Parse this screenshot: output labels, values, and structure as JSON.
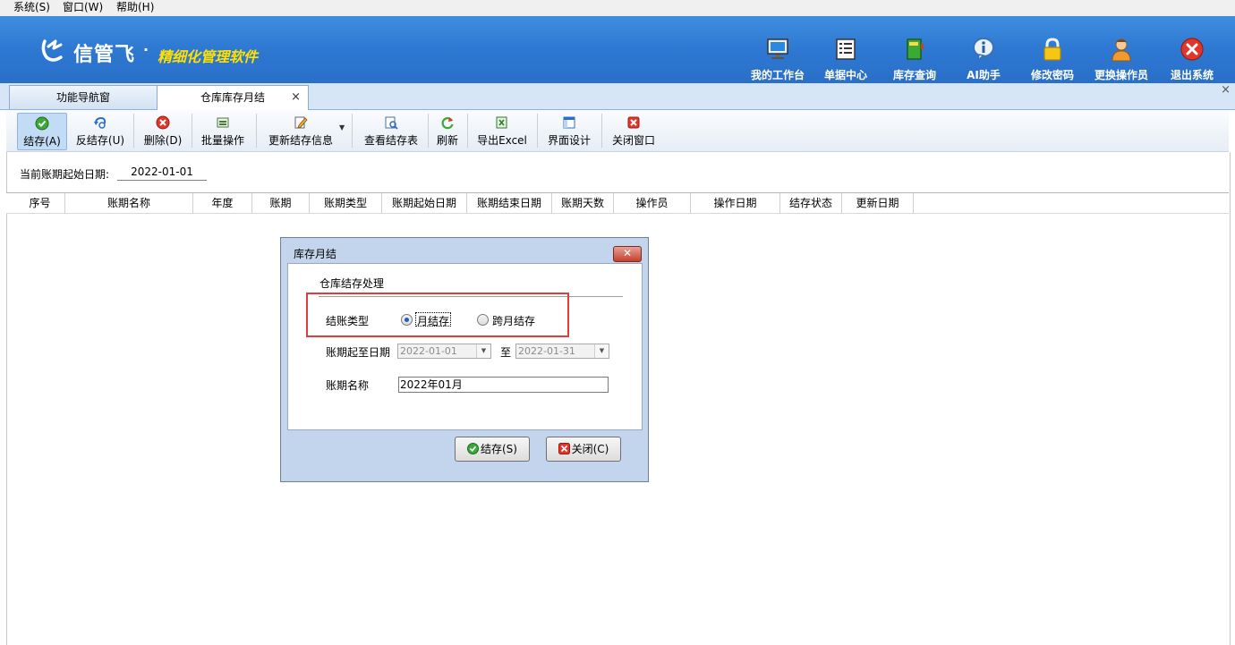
{
  "menu": [
    "系统(S)",
    "窗口(W)",
    "帮助(H)"
  ],
  "banner": {
    "logo_name": "信管飞",
    "logo_dot": "·",
    "slogan": "精细化管理软件",
    "buttons": [
      {
        "label": "我的工作台",
        "icon": "monitor-icon"
      },
      {
        "label": "单据中心",
        "icon": "document-list-icon"
      },
      {
        "label": "库存查询",
        "icon": "book-icon"
      },
      {
        "label": "AI助手",
        "icon": "info-icon"
      },
      {
        "label": "修改密码",
        "icon": "lock-icon"
      },
      {
        "label": "更换操作员",
        "icon": "user-icon"
      },
      {
        "label": "退出系统",
        "icon": "exit-icon"
      }
    ]
  },
  "tabs": [
    {
      "label": "功能导航窗"
    },
    {
      "label": "仓库库存月结",
      "close": "×"
    }
  ],
  "strip_close": "×",
  "toolbar": [
    {
      "label": "结存(A)",
      "icon": "check-icon"
    },
    {
      "label": "反结存(U)",
      "icon": "undo-icon"
    },
    {
      "label": "删除(D)",
      "icon": "delete-icon"
    },
    {
      "label": "批量操作",
      "icon": "batch-icon"
    },
    {
      "label": "更新结存信息",
      "icon": "edit-icon"
    },
    {
      "label": "查看结存表",
      "icon": "view-table-icon"
    },
    {
      "label": "刷新",
      "icon": "refresh-icon"
    },
    {
      "label": "导出Excel",
      "icon": "excel-icon"
    },
    {
      "label": "界面设计",
      "icon": "layout-icon"
    },
    {
      "label": "关闭窗口",
      "icon": "close-window-icon"
    }
  ],
  "period": {
    "label": "当前账期起始日期:",
    "value": "2022-01-01"
  },
  "grid": {
    "columns": [
      "序号",
      "账期名称",
      "年度",
      "账期",
      "账期类型",
      "账期起始日期",
      "账期结束日期",
      "账期天数",
      "操作员",
      "操作日期",
      "结存状态",
      "更新日期"
    ]
  },
  "dialog": {
    "title": "库存月结",
    "close": "✕",
    "section": "仓库结存处理",
    "type_label": "结账类型",
    "option_month": "月结存",
    "option_cross": "跨月结存",
    "selected": "月结存",
    "range_label": "账期起至日期",
    "start_date": "2022-01-01",
    "to": "至",
    "end_date": "2022-01-31",
    "name_label": "账期名称",
    "name_value": "2022年01月",
    "save_button": "结存(S)",
    "close_button": "关闭(C)"
  },
  "colors": {
    "banner": "#2d78d2",
    "slogan": "#ffe000",
    "highlight": "#e03c3c"
  }
}
